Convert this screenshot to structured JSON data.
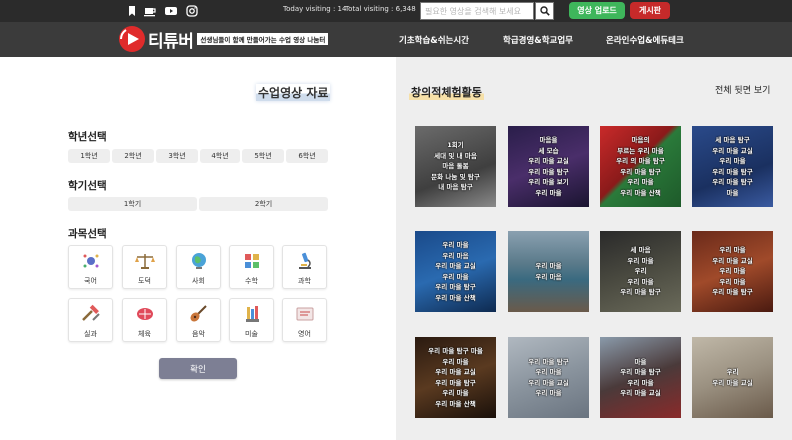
{
  "topbar": {
    "icons": [
      "bookmark-icon",
      "coffee-icon",
      "youtube-icon",
      "instagram-icon"
    ],
    "today_visiting": "Today visiting : 14",
    "total_visiting": "Total visiting : 6,348",
    "search_placeholder": "필요한 영상을 검색해 보세요",
    "upload_label": "영상 업로드",
    "board_label": "게시판"
  },
  "nav": {
    "logo_text": "티튜버",
    "logo_tagline": "선생님들이 함께 만들어가는 수업 영상 나눔터",
    "items": [
      "기초학습&쉬는시간",
      "학급경영&학교업무",
      "온라인수업&에듀테크"
    ]
  },
  "left": {
    "title": "수업영상 자료",
    "grade_title": "학년선택",
    "grades": [
      "1학년",
      "2학년",
      "3학년",
      "4학년",
      "5학년",
      "6학년"
    ],
    "semester_title": "학기선택",
    "semesters": [
      "1학기",
      "2학기"
    ],
    "subject_title": "과목선택",
    "subjects": [
      "국어",
      "도덕",
      "사회",
      "수학",
      "과학",
      "실과",
      "체육",
      "음악",
      "미술",
      "영어"
    ],
    "confirm_label": "확인"
  },
  "right": {
    "title": "창의적체험활동",
    "see_all": "전체 뒷면 보기",
    "thumbnails": [
      {
        "lines": [
          "1회기",
          "세대 및 내 마음",
          "마음 돌봄",
          "문화 나눔 및 탐구",
          "내 마음 탐구"
        ]
      },
      {
        "lines": [
          "마음을",
          "세 모습",
          "우리 마을 교실",
          "우리 마을 탐구",
          "우리 마을 보기",
          "우리 마을"
        ]
      },
      {
        "lines": [
          "마음의",
          "부르는 우리 마을",
          "우리 의 마을 탐구",
          "우리 마을 탐구",
          "우리 마을",
          "우리 마을 산책"
        ]
      },
      {
        "lines": [
          "세 마음 탐구",
          "우리 마을 교실",
          "우리 마을",
          "우리 마을 탐구",
          "우리 마을 탐구",
          "마을"
        ]
      },
      {
        "lines": [
          "우리 마을",
          "우리 마음",
          "우리 마을 교실",
          "우리 마을",
          "우리 마을 탐구",
          "우리 마을 산책"
        ]
      },
      {
        "lines": [
          "우리 마을",
          "우리 마음"
        ]
      },
      {
        "lines": [
          "세 마음",
          "우리 마을",
          "우리",
          "우리 마을",
          "우리 마을 탐구"
        ]
      },
      {
        "lines": [
          "우리 마을",
          "우리 마을 교실",
          "우리 마을",
          "우리 마을",
          "우리 마을 탐구"
        ]
      },
      {
        "lines": [
          "우리 마을 탐구 마을",
          "우리 마을",
          "우리 마을 교실",
          "우리 마을 탐구",
          "우리 마을",
          "우리 마을 산책"
        ]
      },
      {
        "lines": [
          "우리 마을 탐구",
          "우리 마을",
          "우리 마을 교실",
          "우리 마을"
        ]
      },
      {
        "lines": [
          "마을",
          "우리 마을 탐구",
          "우리 마을",
          "우리 마을 교실"
        ]
      },
      {
        "lines": [
          "우리",
          "우리 마을 교실"
        ]
      }
    ]
  },
  "colors": {
    "topbar_bg": "#2b2b2b",
    "navbar_bg": "#3b3b3b",
    "upload_green": "#3eb65b",
    "board_red": "#c62a2a",
    "confirm_gray": "#7d7f94",
    "panel_bg": "#eeeeee"
  }
}
